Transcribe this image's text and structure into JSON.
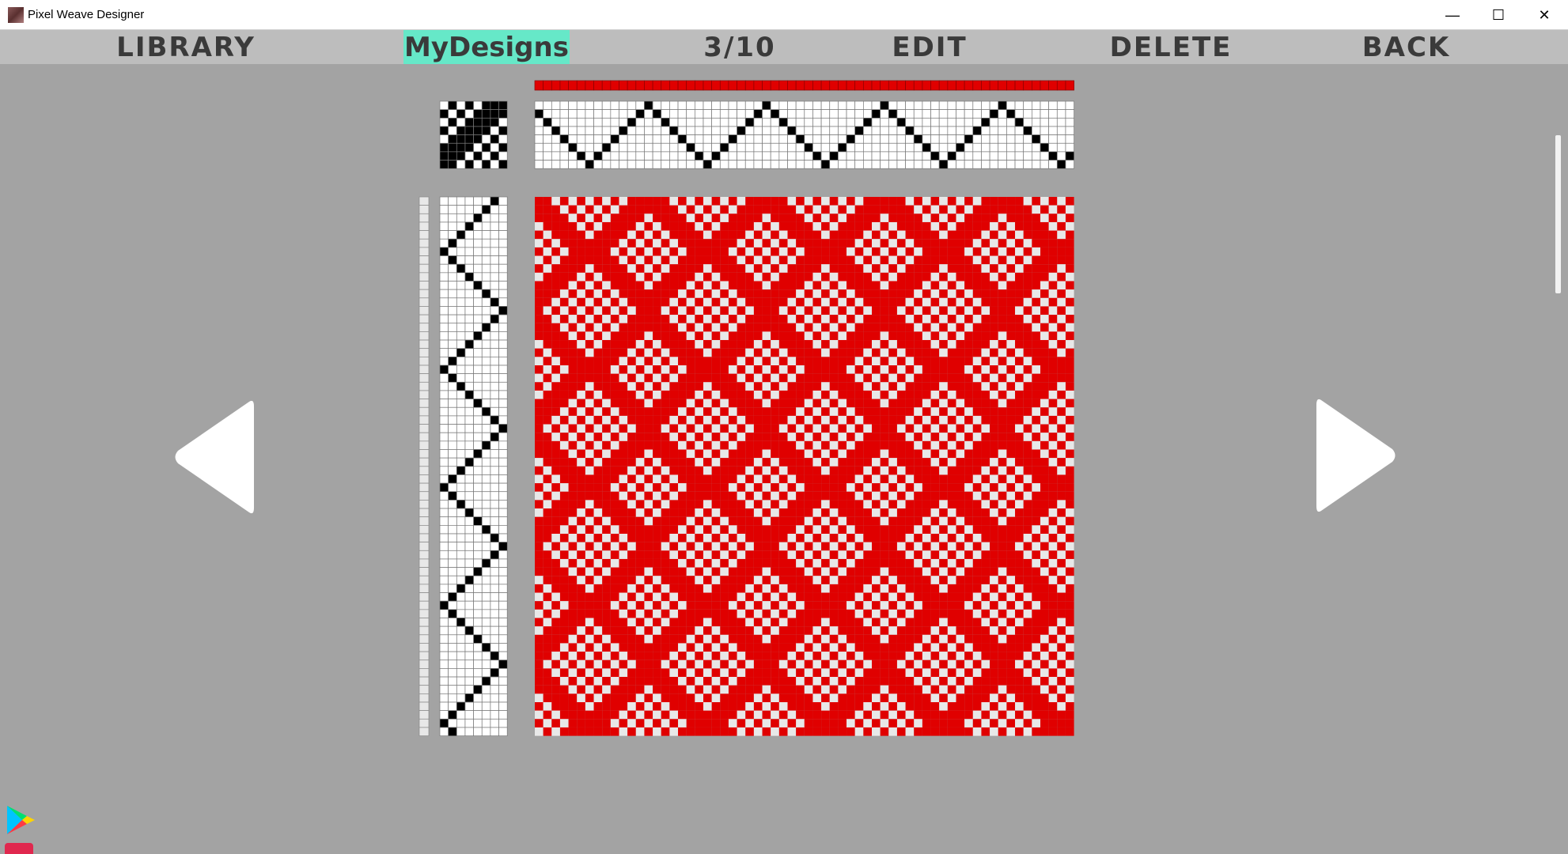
{
  "window": {
    "title": "Pixel Weave Designer",
    "controls": {
      "minimize": "—",
      "maximize": "☐",
      "close": "✕"
    }
  },
  "menu": {
    "library": "LIBRARY",
    "mydesigns": "MyDesigns",
    "counter": "3/10",
    "edit": "EDIT",
    "delete": "DELETE",
    "back": "BACK"
  },
  "colors": {
    "warp": "#e00000",
    "weft": "#e8e8e8",
    "background": "#a3a3a3",
    "menubar": "#bdbdbd",
    "active_tab": "#66e8c8"
  },
  "design": {
    "shafts": 8,
    "threading_ends": 64,
    "treadling_picks": 64,
    "threading_period": 14,
    "tieup": [
      [
        0,
        1,
        0,
        1,
        0,
        1,
        1,
        1
      ],
      [
        1,
        0,
        1,
        0,
        1,
        1,
        1,
        1
      ],
      [
        0,
        1,
        0,
        1,
        1,
        1,
        1,
        0
      ],
      [
        1,
        0,
        1,
        1,
        1,
        1,
        0,
        1
      ],
      [
        0,
        1,
        1,
        1,
        1,
        0,
        1,
        0
      ],
      [
        1,
        1,
        1,
        1,
        0,
        1,
        0,
        1
      ],
      [
        1,
        1,
        1,
        0,
        1,
        0,
        1,
        0
      ],
      [
        1,
        1,
        0,
        1,
        0,
        1,
        0,
        1
      ]
    ]
  },
  "icons": {
    "prev": "triangle-left-icon",
    "next": "triangle-right-icon",
    "play_store": "google-play-icon",
    "store2": "store-icon"
  }
}
